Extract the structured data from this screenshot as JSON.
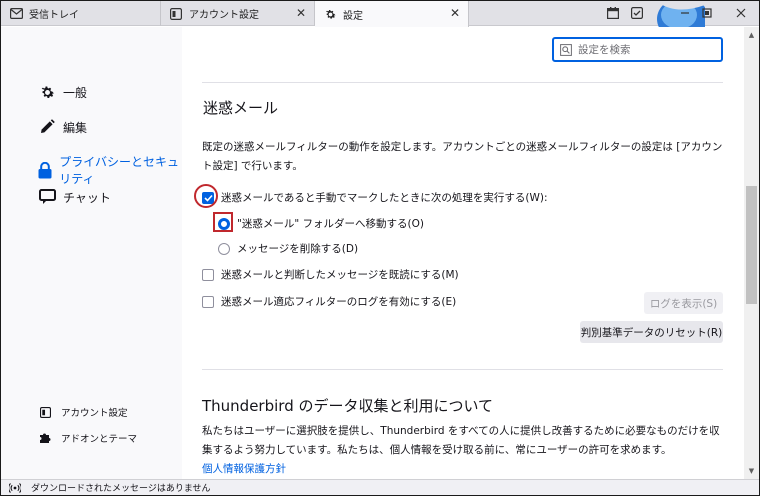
{
  "tabs": [
    {
      "label": "受信トレイ",
      "icon": "mail-icon",
      "closable": false
    },
    {
      "label": "アカウント設定",
      "icon": "account-settings-icon",
      "closable": true
    },
    {
      "label": "設定",
      "icon": "gear-icon",
      "closable": true,
      "active": true
    }
  ],
  "sidebar": {
    "items": [
      {
        "label": "一般",
        "icon": "gear-icon"
      },
      {
        "label": "編集",
        "icon": "pencil-icon"
      },
      {
        "label": "プライバシーとセキュリティ",
        "icon": "lock-icon",
        "selected": true
      },
      {
        "label": "チャット",
        "icon": "chat-bubble-icon"
      }
    ],
    "bottom_items": [
      {
        "label": "アカウント設定",
        "icon": "account-settings-icon"
      },
      {
        "label": "アドオンとテーマ",
        "icon": "puzzle-piece-icon"
      }
    ]
  },
  "search": {
    "placeholder": "設定を検索"
  },
  "junk": {
    "title": "迷惑メール",
    "description": "既定の迷惑メールフィルターの動作を設定します。アカウントごとの迷惑メールフィルターの設定は [アカウント設定] で行います。",
    "manual_mark": {
      "label": "迷惑メールであると手動でマークしたときに次の処理を実行する(W):",
      "checked": true
    },
    "move_option": {
      "label": "\"迷惑メール\" フォルダーへ移動する(O)",
      "selected": true
    },
    "delete_option": {
      "label": "メッセージを削除する(D)",
      "selected": false
    },
    "mark_read": {
      "label": "迷惑メールと判断したメッセージを既読にする(M)",
      "checked": false
    },
    "enable_log": {
      "label": "迷惑メール適応フィルターのログを有効にする(E)",
      "checked": false
    },
    "show_log_button": "ログを表示(S)",
    "reset_button": "判別基準データのリセット(R)"
  },
  "data_collection": {
    "title": "Thunderbird のデータ収集と利用について",
    "description": "私たちはユーザーに選択肢を提供し、Thunderbird をすべての人に提供し改善するために必要なものだけを収集するよう努力しています。私たちは、個人情報を受け取る前に、常にユーザーの許可を求めます。",
    "privacy_link": "個人情報保護方針"
  },
  "status": {
    "text": "ダウンロードされたメッセージはありません"
  },
  "colors": {
    "accent": "#0061e0",
    "highlight": "#c0282d"
  }
}
